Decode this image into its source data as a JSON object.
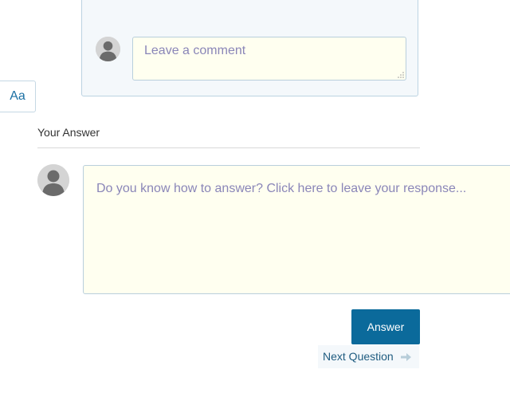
{
  "comment": {
    "placeholder": "Leave a comment"
  },
  "font_toggle": {
    "label": "Aa"
  },
  "answer": {
    "heading": "Your Answer",
    "placeholder": "Do you know how to answer? Click here to leave your response...",
    "submit_label": "Answer",
    "next_label": "Next Question"
  },
  "icons": {
    "avatar": "user-silhouette-icon",
    "resize": "resize-grip-icon",
    "next": "arrow-right-icon"
  },
  "colors": {
    "primary": "#0b6a9b",
    "input_bg": "#fffff0",
    "panel_bg": "#f4f8fb",
    "placeholder": "#8a86b8"
  }
}
